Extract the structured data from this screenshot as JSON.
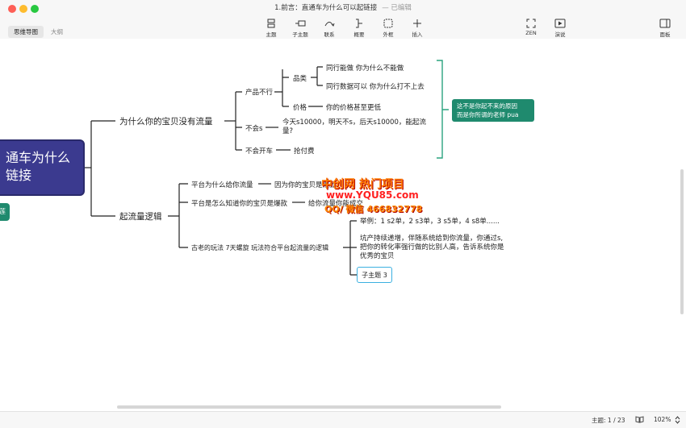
{
  "window": {
    "title": "1.前言：直通车为什么可以起链接",
    "status": "— 已编辑"
  },
  "view_tabs": [
    "思维导图",
    "大纲"
  ],
  "toolbar": {
    "topic": "主题",
    "subtopic": "子主题",
    "relation": "联系",
    "summary": "概要",
    "boundary": "外框",
    "insert": "插入",
    "zen": "ZEN",
    "present": "演说",
    "panel": "面板"
  },
  "mindmap": {
    "central": {
      "line1": "通车为什么",
      "line2": "链接"
    },
    "branch1": {
      "label": "为什么你的宝贝没有流量",
      "product": "产品不行",
      "category": "品类",
      "cat1": "同行能做 你为什么不能做",
      "cat2": "同行数据可以 你为什么打不上去",
      "price": "价格",
      "price1": "你的价格甚至更低",
      "notwork": "不会s",
      "notwork_l1": "今天s10000，明天不s，后天s10000，能起流",
      "notwork_l2": "量?",
      "notopen": "不会开车",
      "notopen1": "抢付费",
      "summary_l1": "这不是你起不来的原因",
      "summary_l2": "而是你所谓的老师 pua"
    },
    "branch2": {
      "label": "起流量逻辑",
      "p1": "平台为什么给你流量",
      "p1a": "因为你的宝贝是爆款",
      "p2": "平台是怎么知道你的宝贝是爆款",
      "p2a": "给你流量你能成交",
      "p3": "古老的玩法 7天螺旋 玩法符合平台起流量的逻辑",
      "p3a": "举例：1 s2单，2 s3单，3 s5单，4 s8单......",
      "p3b_l1": "坑产持续递增，伴随系统给到你流量，你通过s,",
      "p3b_l2": "把你的转化率强行做的比别人高，告诉系统你是",
      "p3b_l3": "优秀的宝贝",
      "p3c": "子主题 3"
    },
    "teal_stub": "莲"
  },
  "watermark": {
    "line1": "中创网 热门项目",
    "line2": "www.YQU85.com",
    "line3": "QQ/ 微信 466832778"
  },
  "statusbar": {
    "topic_count": "主题: 1 / 23",
    "zoom": "102%"
  },
  "colors": {
    "central_bg": "#3b3a8f",
    "summary_bg": "#1f8a6e",
    "bracket": "#2aa37f",
    "connector": "#222222"
  }
}
